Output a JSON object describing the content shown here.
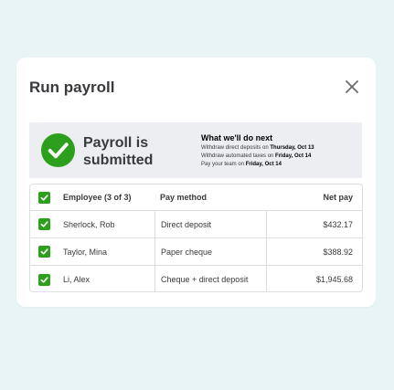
{
  "modal": {
    "title": "Run payroll",
    "close_icon": "close-icon"
  },
  "banner": {
    "status_line1": "Payroll is",
    "status_line2": "submitted",
    "status_icon": "check-circle-icon",
    "next_title": "What we'll do next",
    "steps": [
      {
        "text": "Withdraw direct deposits on ",
        "date": "Thursday, Oct 13"
      },
      {
        "text": "Withdraw automated taxes on ",
        "date": "Friday, Oct 14"
      },
      {
        "text": "Pay your team on ",
        "date": "Friday, Oct 14"
      }
    ]
  },
  "table": {
    "headers": {
      "employee": "Employee (3 of 3)",
      "pay_method": "Pay method",
      "net_pay": "Net pay"
    },
    "rows": [
      {
        "name": "Sherlock, Rob",
        "pay_method": "Direct deposit",
        "net_pay": "$432.17",
        "checked": true
      },
      {
        "name": "Taylor, Mina",
        "pay_method": "Paper cheque",
        "net_pay": "$388.92",
        "checked": true
      },
      {
        "name": "Li, Alex",
        "pay_method": "Cheque + direct deposit",
        "net_pay": "$1,945.68",
        "checked": true
      }
    ]
  },
  "colors": {
    "accent_green": "#2ca01c",
    "background": "#e9f4f7",
    "banner_bg": "#eceef1"
  }
}
